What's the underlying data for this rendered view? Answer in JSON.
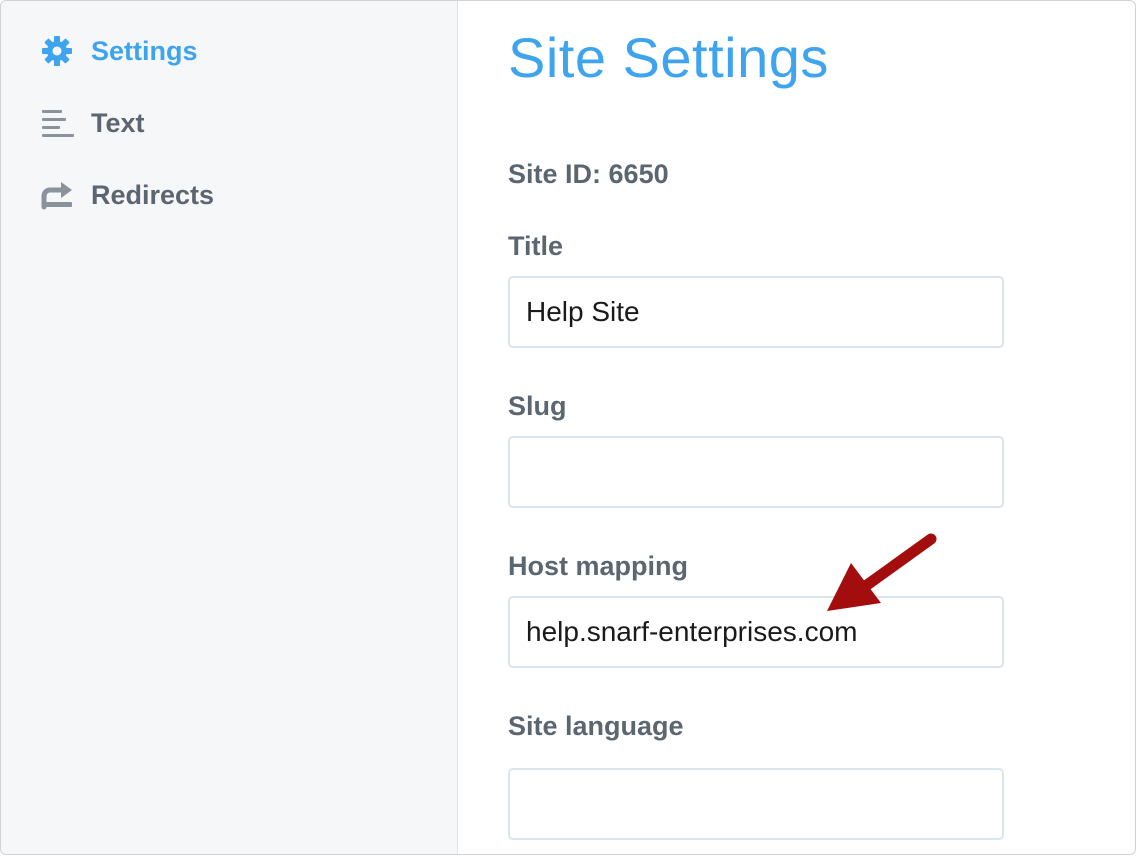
{
  "sidebar": {
    "items": [
      {
        "label": "Settings",
        "icon": "gear-icon",
        "active": true
      },
      {
        "label": "Text",
        "icon": "text-lines-icon",
        "active": false
      },
      {
        "label": "Redirects",
        "icon": "redirect-arrow-icon",
        "active": false
      }
    ]
  },
  "main": {
    "title": "Site Settings",
    "site_id_label": "Site ID:",
    "site_id_value": "6650",
    "fields": [
      {
        "label": "Title",
        "value": "Help Site"
      },
      {
        "label": "Slug",
        "value": ""
      },
      {
        "label": "Host mapping",
        "value": "help.snarf-enterprises.com"
      },
      {
        "label": "Site language",
        "value": ""
      }
    ]
  },
  "annotation": {
    "icon": "pointer-arrow-icon",
    "color": "#a30d0d"
  },
  "colors": {
    "accent": "#3ea4ee",
    "text_muted": "#5c6670",
    "sidebar_bg": "#f6f7f9",
    "input_border": "#dbe5ee"
  }
}
